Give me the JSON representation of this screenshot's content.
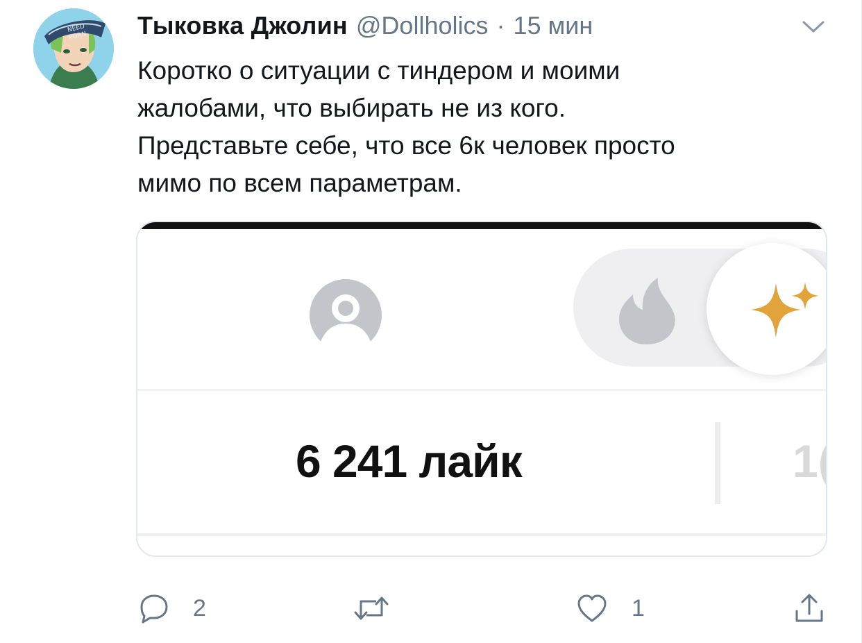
{
  "tweet": {
    "display_name": "Тыковка Джолин",
    "handle": "@Dollholics",
    "separator": "·",
    "time": "15 мин",
    "text": "Коротко о ситуации с тиндером и моими\nжалобами, что выбирать не из кого.\nПредставьте себе, что все 6к человек просто\nмимо по всем параметрам."
  },
  "media": {
    "likes_label": "6 241 лайк",
    "cut_number": "1("
  },
  "actions": {
    "reply_count": "2",
    "like_count": "1"
  },
  "colors": {
    "text": "#14171a",
    "secondary": "#657786",
    "border": "#e1e8ed",
    "gold": "#e0a43b",
    "icon_gray": "#c4c5cb"
  },
  "icons": {
    "reply": "reply-icon",
    "retweet": "retweet-icon",
    "like": "heart-icon",
    "share": "share-icon",
    "chevron": "chevron-down-icon"
  }
}
